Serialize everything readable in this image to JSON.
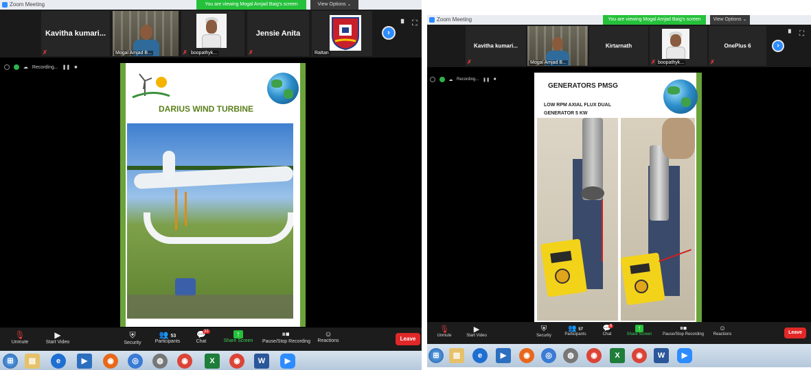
{
  "left": {
    "title": "Zoom Meeting",
    "viewing_banner": "You are viewing Mogal Amjad Baig's screen",
    "view_options": "View Options ⌄",
    "participants": [
      {
        "name": "Kavitha  kumari..."
      },
      {
        "caption": "Mogal Amjad B..."
      },
      {
        "caption": "boopathyk..."
      },
      {
        "name": "Jensie Anita"
      },
      {
        "caption": "Rattan"
      }
    ],
    "recording": "Recording...",
    "slide": {
      "title": "DARIUS WIND TURBINE"
    },
    "controls": {
      "unmute": "Unmute",
      "start_video": "Start Video",
      "security": "Security",
      "participants": "Participants",
      "participants_count": "53",
      "chat": "Chat",
      "chat_badge": "32",
      "share_screen": "Share Screen",
      "pause_stop_recording": "Pause/Stop Recording",
      "reactions": "Reactions",
      "leave": "Leave"
    }
  },
  "right": {
    "title": "Zoom Meeting",
    "viewing_banner": "You are viewing Mogal Amjad Baig's screen",
    "view_options": "View Options ⌄",
    "participants": [
      {
        "name": "Kavitha  kumari..."
      },
      {
        "caption": "Mogal Amjad B..."
      },
      {
        "name": "Kirtarnath"
      },
      {
        "caption": "boopathyk..."
      },
      {
        "name": "OnePlus 6"
      }
    ],
    "recording": "Recording...",
    "slide": {
      "title": "GENERATORS PMSG",
      "subtitle_line1": "LOW RPM AXIAL FLUX DUAL",
      "subtitle_line2": "GENERATOR  5 KW"
    },
    "controls": {
      "unmute": "Unmute",
      "start_video": "Start Video",
      "security": "Security",
      "participants": "Participants",
      "participants_count": "57",
      "chat": "Chat",
      "chat_badge": "6",
      "share_screen": "Share Screen",
      "pause_stop_recording": "Pause/Stop Recording",
      "reactions": "Reactions",
      "leave": "Leave"
    }
  },
  "colors": {
    "zoom_blue": "#2d8cff",
    "banner_green": "#25c13b",
    "leave_red": "#e02828",
    "slide_green": "#6aa33a"
  },
  "icons": {
    "mic": "mic-muted-icon",
    "video": "video-off-icon",
    "security": "shield-icon",
    "participants": "people-icon",
    "chat": "chat-bubble-icon",
    "share": "share-screen-icon",
    "recording": "pause-stop-icon",
    "reactions": "smiley-icon"
  }
}
